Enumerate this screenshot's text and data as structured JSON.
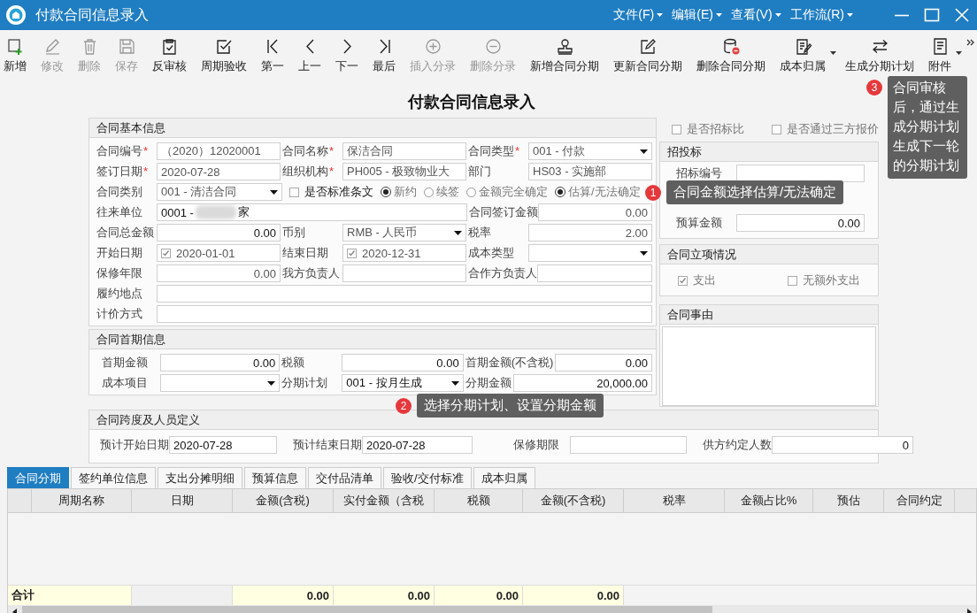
{
  "window": {
    "title": "付款合同信息录入",
    "menus": [
      "文件(F)",
      "编辑(E)",
      "查看(V)",
      "工作流(R)"
    ]
  },
  "toolbar": [
    {
      "label": "新增",
      "disabled": false,
      "dropdown": false
    },
    {
      "label": "修改",
      "disabled": true,
      "dropdown": false
    },
    {
      "label": "删除",
      "disabled": true,
      "dropdown": false
    },
    {
      "label": "保存",
      "disabled": true,
      "dropdown": false
    },
    {
      "label": "反审核",
      "disabled": false,
      "dropdown": false
    },
    {
      "label": "周期验收",
      "disabled": false,
      "dropdown": false
    },
    {
      "label": "第一",
      "disabled": false,
      "dropdown": false
    },
    {
      "label": "上一",
      "disabled": false,
      "dropdown": false
    },
    {
      "label": "下一",
      "disabled": false,
      "dropdown": false
    },
    {
      "label": "最后",
      "disabled": false,
      "dropdown": false
    },
    {
      "label": "插入分录",
      "disabled": true,
      "dropdown": false
    },
    {
      "label": "删除分录",
      "disabled": true,
      "dropdown": false
    },
    {
      "label": "新增合同分期",
      "disabled": false,
      "dropdown": false
    },
    {
      "label": "更新合同分期",
      "disabled": false,
      "dropdown": false
    },
    {
      "label": "删除合同分期",
      "disabled": false,
      "dropdown": false
    },
    {
      "label": "成本归属",
      "disabled": false,
      "dropdown": true
    },
    {
      "label": "生成分期计划",
      "disabled": false,
      "dropdown": false
    },
    {
      "label": "附件",
      "disabled": false,
      "dropdown": true
    }
  ],
  "form_title": "付款合同信息录入",
  "basic_info": {
    "title": "合同基本信息",
    "rows": [
      {
        "items": [
          {
            "kind": "text",
            "label": "合同编号",
            "mark": "*",
            "readonly": true,
            "value": "（2020）12020001"
          },
          {
            "kind": "text",
            "label": "合同名称",
            "mark": "*",
            "readonly": true,
            "value": "保洁合同"
          },
          {
            "kind": "select",
            "label": "合同类型",
            "mark": "*",
            "readonly": true,
            "value": "001 - 付款"
          }
        ]
      },
      {
        "items": [
          {
            "kind": "text",
            "label": "签订日期",
            "mark": "*",
            "readonly": true,
            "value": "2020-07-28"
          },
          {
            "kind": "text",
            "label": "组织机构",
            "mark": "*",
            "readonly": true,
            "value": "PH005 - 极致物业大"
          },
          {
            "kind": "text",
            "label": "部门",
            "readonly": true,
            "value": "HS03 - 实施部"
          }
        ]
      },
      {
        "items": [
          {
            "kind": "select",
            "label": "合同类别",
            "readonly": true,
            "value": "001 - 清洁合同"
          },
          {
            "kind": "checkbox",
            "label": "是否标准条文",
            "checked": false
          },
          {
            "kind": "radio",
            "label": "新约",
            "selected": true
          },
          {
            "kind": "radio",
            "label": "续签",
            "selected": false
          },
          {
            "kind": "radio",
            "label": "金额完全确定",
            "selected": false
          },
          {
            "kind": "radio",
            "label": "估算/无法确定",
            "selected": true
          }
        ]
      },
      {
        "items": [
          {
            "kind": "text",
            "label": "往来单位",
            "readonly": false,
            "value": "0001 -",
            "redacted": true,
            "value_after": "家"
          },
          {
            "kind": "number",
            "label": "合同签订金额",
            "readonly": true,
            "value": "0.00"
          }
        ]
      },
      {
        "items": [
          {
            "kind": "number",
            "label": "合同总金额",
            "readonly": false,
            "value": "0.00"
          },
          {
            "kind": "select",
            "label": "币别",
            "readonly": true,
            "value": "RMB - 人民币"
          },
          {
            "kind": "number",
            "label": "税率",
            "readonly": true,
            "value": "2.00"
          }
        ]
      },
      {
        "items": [
          {
            "kind": "date",
            "label": "开始日期",
            "readonly": true,
            "checked": true,
            "value": "2020-01-01"
          },
          {
            "kind": "date",
            "label": "结束日期",
            "readonly": true,
            "checked": true,
            "value": "2020-12-31"
          },
          {
            "kind": "select",
            "label": "成本类型"
          }
        ]
      },
      {
        "items": [
          {
            "kind": "number",
            "label": "保修年限",
            "readonly": true,
            "value": "0.00"
          },
          {
            "kind": "text",
            "label": "我方负责人"
          },
          {
            "kind": "text",
            "label": "合作方负责人"
          }
        ]
      },
      {
        "items": [
          {
            "kind": "text",
            "label": "履约地点"
          }
        ]
      },
      {
        "items": [
          {
            "kind": "text",
            "label": "计价方式"
          }
        ]
      }
    ]
  },
  "first_period": {
    "title": "合同首期信息",
    "rows": [
      [
        {
          "label": "首期金额",
          "kind": "number",
          "value": "0.00"
        },
        {
          "label": "税额",
          "kind": "number",
          "value": "0.00"
        },
        {
          "label": "首期金额(不含税)",
          "kind": "number",
          "value": "0.00"
        }
      ],
      [
        {
          "label": "成本项目",
          "kind": "select"
        },
        {
          "label": "分期计划",
          "kind": "select",
          "value": "001 - 按月生成"
        },
        {
          "label": "分期金额",
          "kind": "number",
          "value": "20,000.00"
        }
      ]
    ]
  },
  "options": [
    {
      "label": "是否招标比",
      "checked": false
    },
    {
      "label": "是否通过三方报价",
      "checked": false
    }
  ],
  "bidding": {
    "title": "招投标",
    "fields": [
      {
        "label": "招标编号"
      },
      {
        "label": "预算金额",
        "value": "0.00"
      }
    ]
  },
  "approval": {
    "title": "合同立项情况",
    "options": [
      {
        "label": "支出",
        "checked": true
      },
      {
        "label": "无额外支出",
        "checked": false
      }
    ]
  },
  "reason": {
    "title": "合同事由"
  },
  "span_info": {
    "title": "合同跨度及人员定义",
    "fields": [
      {
        "label": "预计开始日期",
        "kind": "text",
        "value": "2020-07-28"
      },
      {
        "label": "预计结束日期",
        "kind": "text",
        "value": "2020-07-28"
      },
      {
        "label": "保修期限",
        "kind": "text"
      },
      {
        "label": "供方约定人数",
        "kind": "number",
        "value": "0"
      }
    ]
  },
  "tabs": [
    {
      "label": "合同分期",
      "selected": true
    },
    {
      "label": "签约单位信息",
      "selected": false
    },
    {
      "label": "支出分摊明细",
      "selected": false
    },
    {
      "label": "预算信息",
      "selected": false
    },
    {
      "label": "交付品清单",
      "selected": false
    },
    {
      "label": "验收/交付标准",
      "selected": false
    },
    {
      "label": "成本归属",
      "selected": false
    }
  ],
  "table": {
    "columns": [
      "周期名称",
      "日期",
      "金额(含税)",
      "实付金额（含税",
      "税额",
      "金额(不含税)",
      "税率",
      "金额占比%",
      "预估",
      "合同约定"
    ],
    "total_row": {
      "label": "合计",
      "cells": [
        "",
        "0.00",
        "0.00",
        "0.00",
        "0.00"
      ]
    }
  },
  "callouts": [
    {
      "number": "1",
      "text": "合同金额选择估算/无法确定"
    },
    {
      "number": "2",
      "text": "选择分期计划、设置分期金额"
    },
    {
      "number": "3",
      "text": "合同审核后，通过生成分期计划生成下一轮的分期计划"
    }
  ]
}
